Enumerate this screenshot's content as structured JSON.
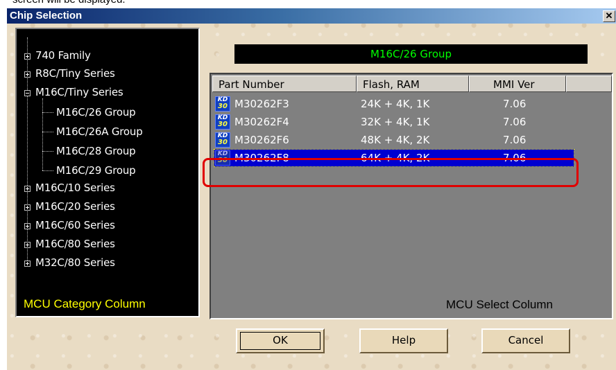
{
  "doc_fragment": "screen will be displayed.",
  "window": {
    "title": "Chip Selection",
    "close_symbol": "✕"
  },
  "category_panel": {
    "items": [
      {
        "label": "740 Family",
        "expander": "plus"
      },
      {
        "label": "R8C/Tiny Series",
        "expander": "plus"
      },
      {
        "label": "M16C/Tiny Series",
        "expander": "minus"
      },
      {
        "label": "M16C/26 Group",
        "expander": "none"
      },
      {
        "label": "M16C/26A Group",
        "expander": "none"
      },
      {
        "label": "M16C/28 Group",
        "expander": "none"
      },
      {
        "label": "M16C/29 Group",
        "expander": "none"
      },
      {
        "label": "M16C/10 Series",
        "expander": "plus"
      },
      {
        "label": "M16C/20 Series",
        "expander": "plus"
      },
      {
        "label": "M16C/60 Series",
        "expander": "plus"
      },
      {
        "label": "M16C/80 Series",
        "expander": "plus"
      },
      {
        "label": "M32C/80 Series",
        "expander": "plus"
      }
    ],
    "caption": "MCU Category Column",
    "caption_color": "#ffff00"
  },
  "group_banner": {
    "text": "M16C/26 Group",
    "color": "#00ff00"
  },
  "select_panel": {
    "columns": [
      "Part Number",
      "Flash, RAM",
      "MMI Ver"
    ],
    "rows": [
      {
        "part": "M30262F3",
        "flash_ram": "24K + 4K, 1K",
        "mmi": "7.06",
        "icon_top": "KD",
        "icon_bottom": "30",
        "selected": false
      },
      {
        "part": "M30262F4",
        "flash_ram": "32K + 4K, 1K",
        "mmi": "7.06",
        "icon_top": "KD",
        "icon_bottom": "30",
        "selected": false
      },
      {
        "part": "M30262F6",
        "flash_ram": "48K + 4K, 2K",
        "mmi": "7.06",
        "icon_top": "KD",
        "icon_bottom": "30",
        "selected": false
      },
      {
        "part": "M30262F8",
        "flash_ram": "64K + 4K, 2K",
        "mmi": "7.06",
        "icon_top": "KD",
        "icon_bottom": "30",
        "selected": true
      }
    ],
    "caption": "MCU Select Column",
    "highlight_color": "#e00000",
    "selection_color": "#0000d0"
  },
  "buttons": {
    "ok": "OK",
    "help": "Help",
    "cancel": "Cancel"
  }
}
